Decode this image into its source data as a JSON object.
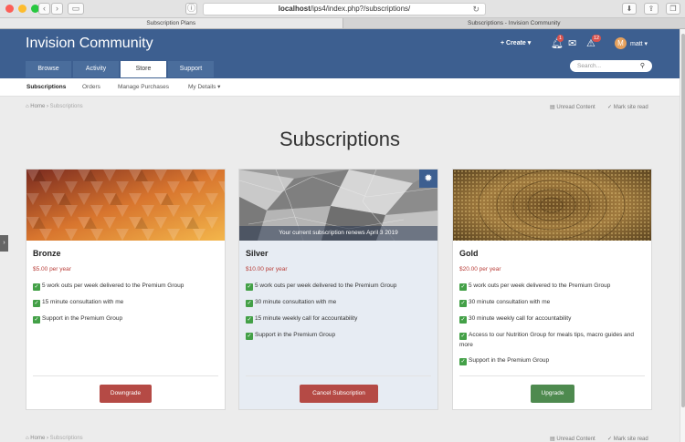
{
  "browser": {
    "url_host": "localhost",
    "url_path": "/ips4/index.php?/subscriptions/",
    "tabs": [
      "Subscription Plans",
      "Subscriptions - Invision Community"
    ]
  },
  "header": {
    "site_title": "Invision Community",
    "create_label": "+ Create ▾",
    "notifications_count": "1",
    "reports_count": "12",
    "avatar_letter": "M",
    "user_label": "matt ▾",
    "search_placeholder": "Search...",
    "nav": [
      "Browse",
      "Activity",
      "Store",
      "Support"
    ]
  },
  "subnav": [
    "Subscriptions",
    "Orders",
    "Manage Purchases",
    "My Details ▾"
  ],
  "breadcrumb": {
    "home": "Home",
    "separator": "›",
    "current": "Subscriptions",
    "unread": "Unread Content",
    "mark_read": "Mark site read"
  },
  "page_title": "Subscriptions",
  "plans": [
    {
      "name": "Bronze",
      "price": "$5.00 per year",
      "features": [
        "5 work outs per week delivered to the Premium Group",
        "15 minute consultation with me",
        "Support in the Premium Group"
      ],
      "button": "Downgrade"
    },
    {
      "name": "Silver",
      "price": "$10.00 per year",
      "renewal": "Your current subscription renews April 3 2019",
      "features": [
        "5 work outs per week delivered to the Premium Group",
        "30 minute consultation with me",
        "15 minute weekly call for accountability",
        "Support in the Premium Group"
      ],
      "button": "Cancel Subscription"
    },
    {
      "name": "Gold",
      "price": "$20.00 per year",
      "features": [
        "5 work outs per week delivered to the Premium Group",
        "30 minute consultation with me",
        "30 minute weekly call for accountability",
        "Access to our Nutrition Group for meals tips, macro guides and more",
        "Support in the Premium Group"
      ],
      "button": "Upgrade"
    }
  ],
  "colors": {
    "header": "#3d5f90",
    "price": "#b93f3a",
    "downgrade": "#b54a45",
    "upgrade": "#4e8a4f",
    "current_card": "#e7ecf3"
  }
}
